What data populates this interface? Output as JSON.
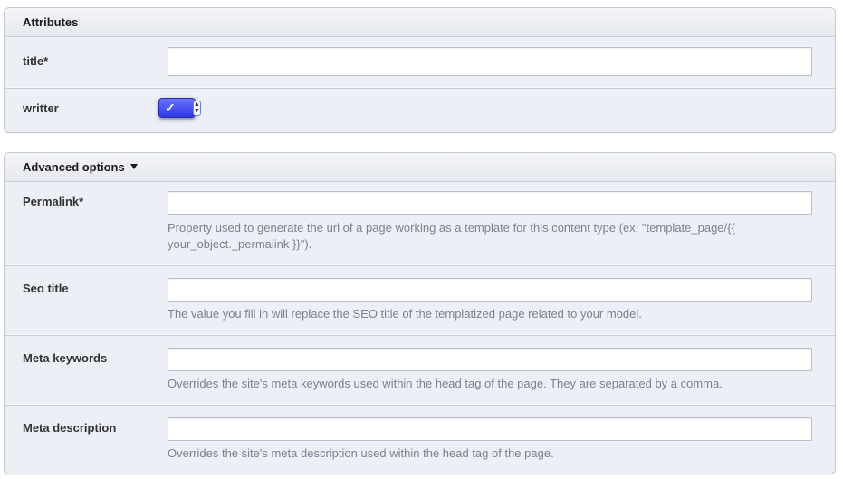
{
  "attributes": {
    "header": "Attributes",
    "title_field": {
      "label": "title*",
      "value": ""
    },
    "writter_field": {
      "label": "writter",
      "selected": "✓"
    }
  },
  "advanced": {
    "header": "Advanced options",
    "permalink": {
      "label": "Permalink*",
      "value": "",
      "hint_line1": "Property used to generate the url of a page working as a template for this content type (ex: \"template_page/{{",
      "hint_line2": "your_object._permalink }}\")."
    },
    "seo_title": {
      "label": "Seo title",
      "value": "",
      "hint": "The value you fill in will replace the SEO title of the templatized page related to your model."
    },
    "meta_keywords": {
      "label": "Meta keywords",
      "value": "",
      "hint": "Overrides the site's meta keywords used within the head tag of the page. They are separated by a comma."
    },
    "meta_description": {
      "label": "Meta description",
      "value": "",
      "hint": "Overrides the site's meta description used within the head tag of the page."
    }
  },
  "colors": {
    "panel_bg": "#eceff5",
    "select_accent": "#3b44f0",
    "hint_text": "#7d818a"
  }
}
